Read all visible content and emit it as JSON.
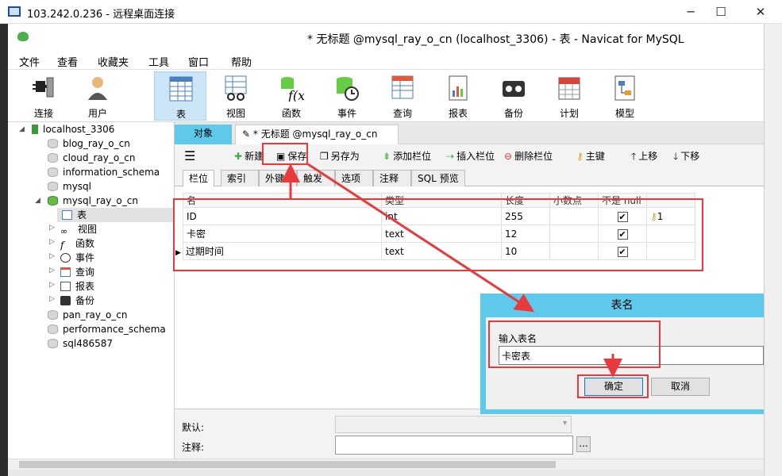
{
  "rdp": {
    "title": "103.242.0.236 - 远程桌面连接",
    "minimize": "─",
    "maximize": "☐",
    "close": "✕"
  },
  "window": {
    "title": "* 无标题 @mysql_ray_o_cn (localhost_3306) - 表 - Navicat for MySQL"
  },
  "menu": [
    "文件",
    "查看",
    "收藏夹",
    "工具",
    "窗口",
    "帮助"
  ],
  "toolbar": [
    {
      "label": "连接",
      "icon": "plug-icon"
    },
    {
      "label": "用户",
      "icon": "user-icon"
    },
    {
      "label": "表",
      "icon": "table-icon"
    },
    {
      "label": "视图",
      "icon": "view-icon"
    },
    {
      "label": "函数",
      "icon": "function-icon"
    },
    {
      "label": "事件",
      "icon": "event-icon"
    },
    {
      "label": "查询",
      "icon": "query-icon"
    },
    {
      "label": "报表",
      "icon": "report-icon"
    },
    {
      "label": "备份",
      "icon": "backup-icon"
    },
    {
      "label": "计划",
      "icon": "calendar-icon"
    },
    {
      "label": "模型",
      "icon": "model-icon"
    }
  ],
  "tree": {
    "connection": "localhost_3306",
    "dbs_before": [
      "blog_ray_o_cn",
      "cloud_ray_o_cn",
      "information_schema",
      "mysql"
    ],
    "open_db": "mysql_ray_o_cn",
    "open_children": [
      "表",
      "视图",
      "函数",
      "事件",
      "查询",
      "报表",
      "备份"
    ],
    "dbs_after": [
      "pan_ray_o_cn",
      "performance_schema",
      "sql486587"
    ]
  },
  "tabs": {
    "objects": "对象",
    "current": "* 无标题 @mysql_ray_o_cn (l..."
  },
  "edit_toolbar": {
    "new": "新建",
    "save": "保存",
    "save_as": "另存为",
    "add_field": "添加栏位",
    "insert_field": "插入栏位",
    "delete_field": "删除栏位",
    "primary_key": "主键",
    "move_up": "上移",
    "move_down": "下移"
  },
  "field_tabs": [
    "栏位",
    "索引",
    "外键",
    "触发器",
    "选项",
    "注释",
    "SQL 预览"
  ],
  "table": {
    "headers": [
      "名",
      "类型",
      "长度",
      "小数点",
      "不是 null",
      ""
    ],
    "rows": [
      {
        "name": "ID",
        "type": "int",
        "length": "255",
        "decimals": "",
        "not_null": "✔",
        "key": "1"
      },
      {
        "name": "卡密",
        "type": "text",
        "length": "12",
        "decimals": "",
        "not_null": "✔",
        "key": ""
      },
      {
        "name": "过期时间",
        "type": "text",
        "length": "10",
        "decimals": "",
        "not_null": "✔",
        "key": ""
      }
    ]
  },
  "props": {
    "default_label": "默认:",
    "comment_label": "注释:",
    "browse": "..."
  },
  "dialog": {
    "title": "表名",
    "prompt": "输入表名",
    "value": "卡密表",
    "ok": "确定",
    "cancel": "取消"
  },
  "colors": {
    "highlight": "#e83a3a",
    "dialog": "#5fc9eb",
    "active_tab": "#cde6f7"
  }
}
